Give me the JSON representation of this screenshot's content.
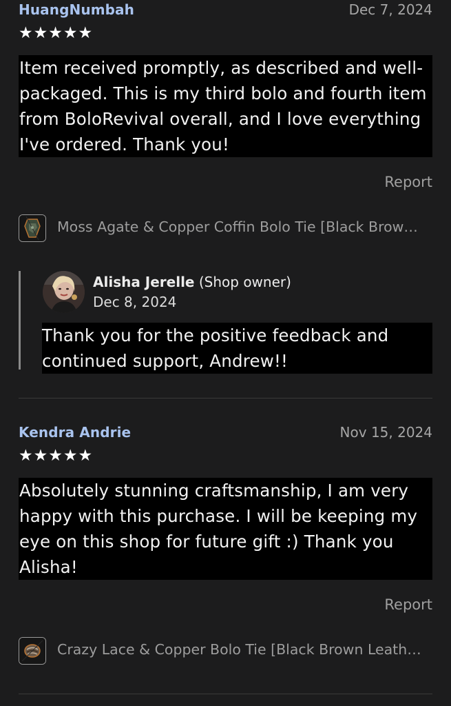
{
  "reviews": [
    {
      "author": "HuangNumbah",
      "date": "Dec 7, 2024",
      "rating": 5,
      "stars": "★★★★★",
      "text": "Item received promptly, as described and well-packaged. This is my third bolo and fourth item from BoloRevival overall, and I love everything I've ordered. Thank you!",
      "report_label": "Report",
      "item": {
        "title": "Moss Agate & Copper Coffin Bolo Tie [Black Brow…",
        "thumb_icon": "bolo-tie-thumbnail"
      },
      "reply": {
        "name": "Alisha Jerelle",
        "role": "(Shop owner)",
        "date": "Dec 8, 2024",
        "text": "Thank you for the positive feedback and continued support, Andrew!!"
      }
    },
    {
      "author": "Kendra Andrie",
      "date": "Nov 15, 2024",
      "rating": 5,
      "stars": "★★★★★",
      "text": "Absolutely stunning craftsmanship, I am very happy with this purchase. I will be keeping my eye on this shop for future gift :) Thank you Alisha!",
      "report_label": "Report",
      "item": {
        "title": "Crazy Lace & Copper Bolo Tie [Black Brown Leath…",
        "thumb_icon": "bolo-tie-thumbnail"
      }
    }
  ],
  "colors": {
    "background": "#1c1c1d",
    "author": "#a9c3ee",
    "text_highlight": "#000000",
    "muted": "#a0a0a0"
  }
}
